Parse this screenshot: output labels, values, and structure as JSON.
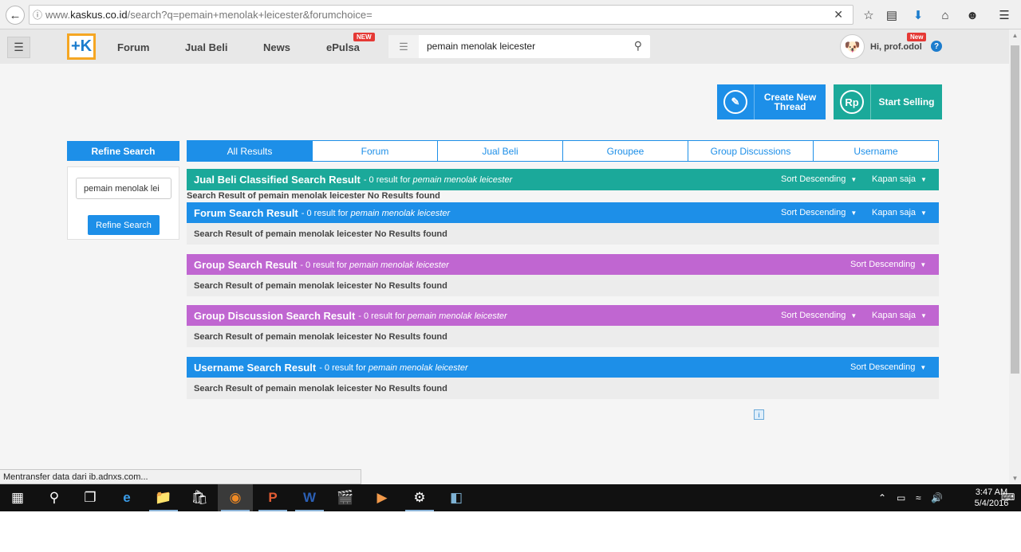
{
  "browser": {
    "url_prefix": "www.",
    "url_domain": "kaskus.co.id",
    "url_path": "/search?q=pemain+menolak+leicester&forumchoice="
  },
  "header": {
    "nav": [
      "Forum",
      "Jual Beli",
      "News",
      "ePulsa"
    ],
    "new_badge": "NEW",
    "search_value": "pemain menolak leicester",
    "user_badge": "New",
    "greeting": "Hi, prof.odol",
    "help": "?"
  },
  "actions": {
    "create_thread": "Create New Thread",
    "create_icon": "✎",
    "start_selling": "Start Selling",
    "selling_icon": "Rp"
  },
  "refine": {
    "title": "Refine Search",
    "input_value": "pemain menolak lei",
    "button": "Refine Search"
  },
  "tabs": [
    "All Results",
    "Forum",
    "Jual Beli",
    "Groupee",
    "Group Discussions",
    "Username"
  ],
  "sections": [
    {
      "title": "Jual Beli Classified Search Result",
      "count": "- 0 result for",
      "query": "pemain menolak leicester",
      "sort": "Sort Descending",
      "time": "Kapan saja",
      "empty": "Search Result of pemain menolak leicester No Results found",
      "color": "#1ba99a"
    },
    {
      "title": "Forum Search Result",
      "count": "- 0 result for",
      "query": "pemain menolak leicester",
      "sort": "Sort Descending",
      "time": "Kapan saja",
      "empty": "Search Result of pemain menolak leicester No Results found",
      "color": "#1d8fe8"
    },
    {
      "title": "Group Search Result",
      "count": "- 0 result for",
      "query": "pemain menolak leicester",
      "sort": "Sort Descending",
      "time": "",
      "empty": "Search Result of pemain menolak leicester No Results found",
      "color": "#c066d1"
    },
    {
      "title": "Group Discussion Search Result",
      "count": "- 0 result for",
      "query": "pemain menolak leicester",
      "sort": "Sort Descending",
      "time": "Kapan saja",
      "empty": "Search Result of pemain menolak leicester No Results found",
      "color": "#c066d1"
    },
    {
      "title": "Username Search Result",
      "count": "- 0 result for",
      "query": "pemain menolak leicester",
      "sort": "Sort Descending",
      "time": "",
      "empty": "Search Result of pemain menolak leicester No Results found",
      "color": "#1d8fe8"
    }
  ],
  "status_bar": "Mentransfer data dari ib.adnxs.com...",
  "taskbar": {
    "time": "3:47 AM",
    "date": "5/4/2016"
  }
}
